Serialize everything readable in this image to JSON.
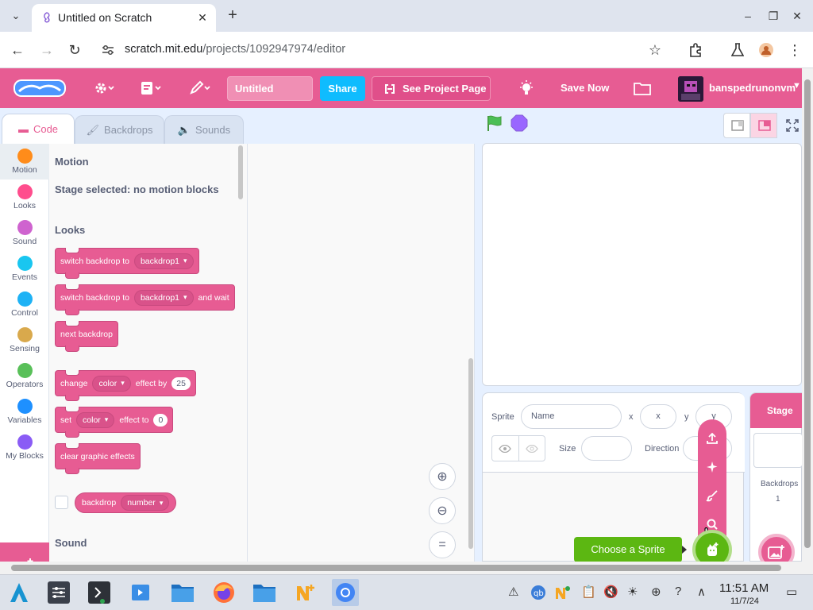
{
  "browser": {
    "tab_title": "Untitled on Scratch",
    "url_domain": "scratch.mit.edu",
    "url_path": "/projects/1092947974/editor"
  },
  "menubar": {
    "project_title": "Untitled",
    "share_label": "Share",
    "see_project_label": "See Project Page",
    "save_now_label": "Save Now",
    "username": "banspedrunonvm"
  },
  "editor_tabs": [
    {
      "label": "Code"
    },
    {
      "label": "Backdrops"
    },
    {
      "label": "Sounds"
    }
  ],
  "categories": [
    {
      "label": "Motion",
      "color": "#ff8c1a"
    },
    {
      "label": "Looks",
      "color": "#ff4d8d"
    },
    {
      "label": "Sound",
      "color": "#cf63cf"
    },
    {
      "label": "Events",
      "color": "#19c6f0"
    },
    {
      "label": "Control",
      "color": "#1eb2f5"
    },
    {
      "label": "Sensing",
      "color": "#d9a94c"
    },
    {
      "label": "Operators",
      "color": "#59c059"
    },
    {
      "label": "Variables",
      "color": "#1e90ff"
    },
    {
      "label": "My Blocks",
      "color": "#8a5cf5"
    }
  ],
  "palette": {
    "motion_heading": "Motion",
    "motion_note": "Stage selected: no motion blocks",
    "looks_heading": "Looks",
    "sound_heading": "Sound",
    "blocks": {
      "switch1_text": "switch backdrop to",
      "switch1_value": "backdrop1",
      "switch2_text": "switch backdrop to",
      "switch2_value": "backdrop1",
      "switch2_suffix": "and wait",
      "next_text": "next backdrop",
      "change_text": "change",
      "change_effect": "color",
      "change_mid": "effect by",
      "change_value": "25",
      "set_text": "set",
      "set_effect": "color",
      "set_mid": "effect to",
      "set_value": "0",
      "clear_text": "clear graphic effects",
      "reporter_text": "backdrop",
      "reporter_value": "number"
    }
  },
  "sprite_info": {
    "sprite_label": "Sprite",
    "name_placeholder": "Name",
    "x_label": "x",
    "x_placeholder": "x",
    "y_label": "y",
    "y_placeholder": "y",
    "size_label": "Size",
    "direction_label": "Direction"
  },
  "stage_pane": {
    "title": "Stage",
    "backdrops_label": "Backdrops",
    "backdrops_count": "1"
  },
  "choose_sprite_label": "Choose a Sprite",
  "clock": {
    "time": "11:51 AM",
    "date": "11/7/24"
  },
  "colors": {
    "scratch_pink": "#e75c93",
    "share_blue": "#0fbcfe",
    "sprite_green": "#5cb712"
  }
}
